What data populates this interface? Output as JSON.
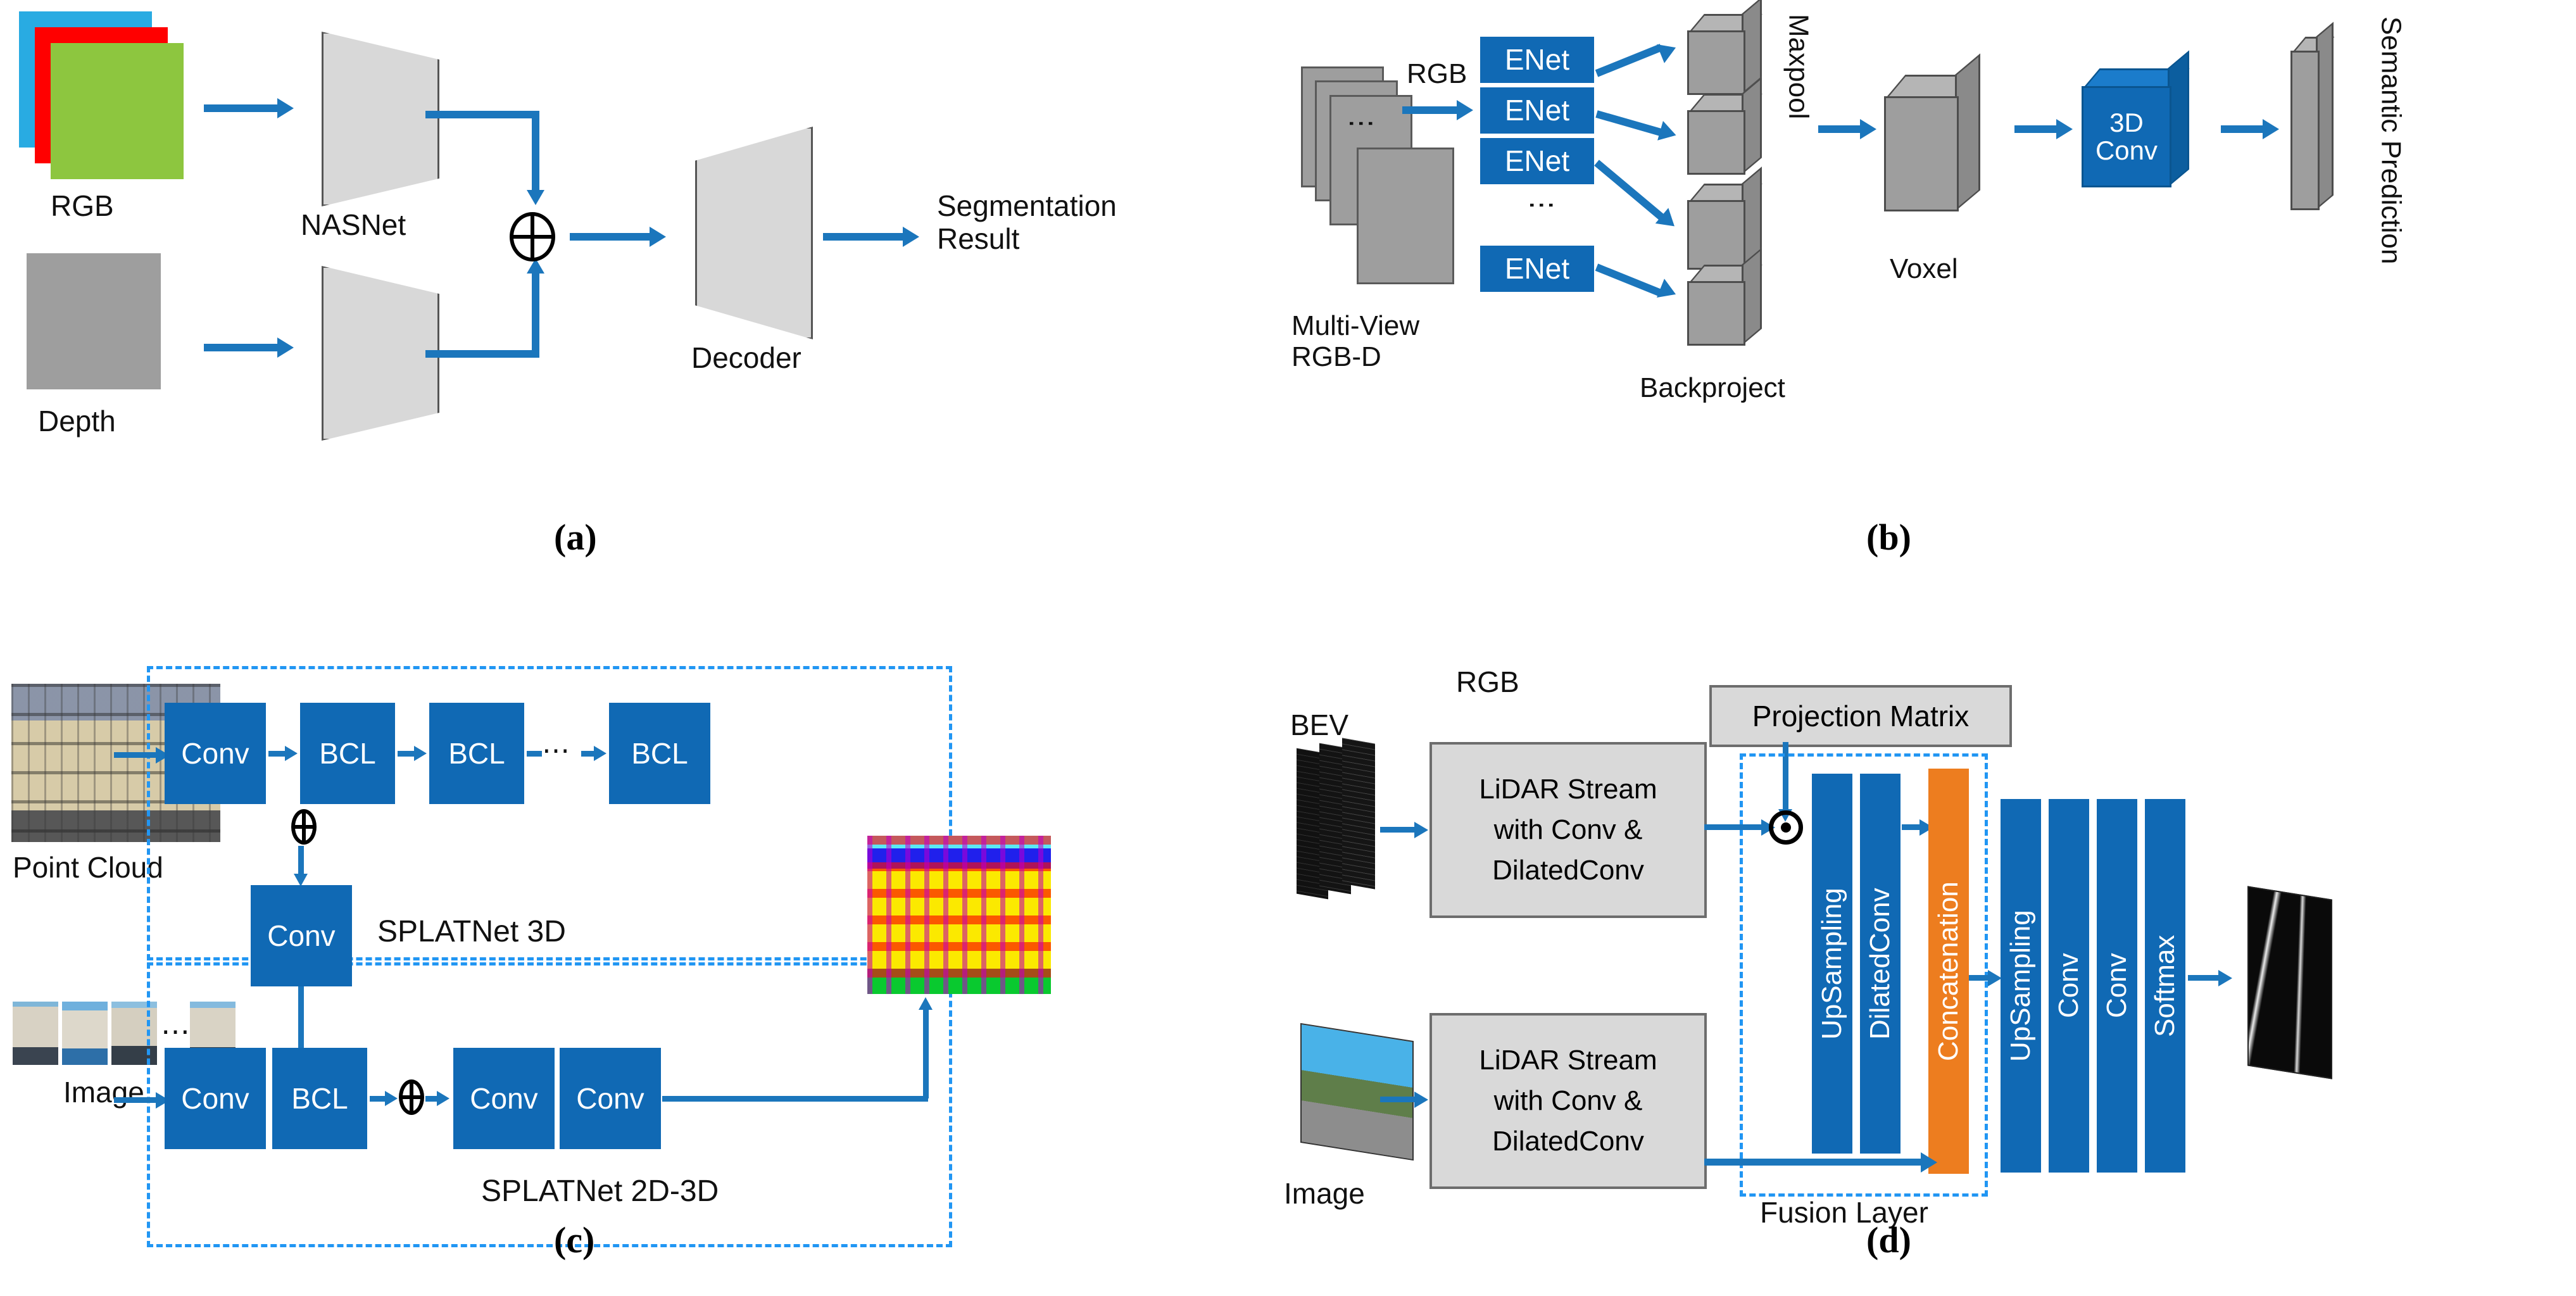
{
  "figure": {
    "panels": [
      {
        "id": "a",
        "label": "(a)"
      },
      {
        "id": "b",
        "label": "(b)"
      },
      {
        "id": "c",
        "label": "(c)"
      },
      {
        "id": "d",
        "label": "(d)"
      }
    ]
  },
  "colors": {
    "blue_box": "#1069B4",
    "arrow_blue": "#1B76BC",
    "dashed_blue": "#2196F3",
    "orange": "#ED7D1F",
    "gray_box": "#D9D9D9",
    "cube_gray": "#9E9E9E",
    "rgb_red": "#FF0000",
    "rgb_green": "#8DC63F",
    "rgb_blue": "#29ABE2",
    "trapezoid": "#D8D8D8"
  },
  "panel_a": {
    "inputs": [
      {
        "name": "RGB",
        "label": "RGB"
      },
      {
        "name": "Depth",
        "label": "Depth"
      }
    ],
    "encoder_top_label": "NASNet",
    "encoder_bottom_label": "",
    "fusion_symbol": "oplus",
    "decoder_label": "Decoder",
    "output_label": "Segmentation\nResult"
  },
  "panel_b": {
    "input_label": "Multi-View\nRGB-D",
    "rgb_label": "RGB",
    "enet_label": "ENet",
    "enet_count": 4,
    "backproject_label": "Backproject",
    "maxpool_label": "Maxpool",
    "voxel_label": "Voxel",
    "conv3d_label": "3D\nConv",
    "output_label": "Semantic Prediction",
    "vertical_dots": "⋮"
  },
  "panel_c": {
    "point_cloud_label": "Point Cloud",
    "image_label": "Image",
    "top_row": [
      "Conv",
      "BCL",
      "BCL",
      "BCL"
    ],
    "top_row_ellipsis": "⋯",
    "mid_conv": "Conv",
    "bottom_row": [
      "Conv",
      "BCL",
      "Conv",
      "Conv"
    ],
    "group_top_label": "SPLATNet 3D",
    "group_bottom_label": "SPLATNet 2D-3D",
    "image_ellipsis": "⋯",
    "fusion_symbol": "oplus"
  },
  "panel_d": {
    "bev_label": "BEV",
    "rgb_label": "RGB",
    "image_label": "Image",
    "stream_top_label": "LiDAR Stream\nwith Conv &\nDilatedConv",
    "stream_bottom_label": "LiDAR Stream\nwith Conv &\nDilatedConv",
    "projection_matrix_label": "Projection Matrix",
    "fusion_symbol": "odot",
    "fusion_layer_label": "Fusion Layer",
    "fusion_blocks": [
      "UpSampling",
      "DilatedConv"
    ],
    "concat_label": "Concatenation",
    "tail_blocks": [
      "UpSampling",
      "Conv",
      "Conv",
      "Softmax"
    ]
  }
}
